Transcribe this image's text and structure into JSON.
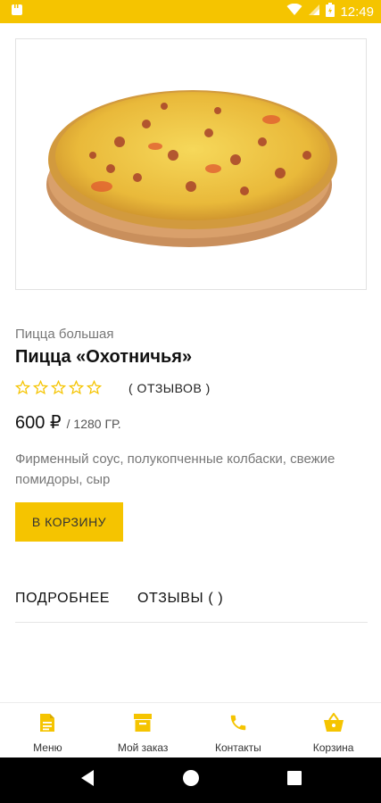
{
  "status_bar": {
    "time": "12:49",
    "icons": [
      "notification-icon",
      "wifi-icon",
      "signal-icon",
      "battery-icon"
    ]
  },
  "product": {
    "image": "pizza-image",
    "category": "Пицца большая",
    "title": "Пицца «Охотничья»",
    "rating": {
      "stars_filled": 0,
      "stars_total": 5,
      "reviews_label": "(  ОТЗЫВОВ )"
    },
    "price": "600 ₽",
    "weight": "/ 1280 ГР.",
    "description": "Фирменный соус, полукопченные колбаски, свежие помидоры, сыр"
  },
  "actions": {
    "add_to_cart": "В КОРЗИНУ"
  },
  "tabs": [
    {
      "label": "ПОДРОБНЕЕ"
    },
    {
      "label": "ОТЗЫВЫ (  )"
    }
  ],
  "bottom_nav": [
    {
      "label": "Меню",
      "icon": "menu-document-icon"
    },
    {
      "label": "Мой заказ",
      "icon": "order-box-icon"
    },
    {
      "label": "Контакты",
      "icon": "phone-icon"
    },
    {
      "label": "Корзина",
      "icon": "basket-icon"
    }
  ],
  "system_nav": [
    "back-icon",
    "home-icon",
    "recents-icon"
  ],
  "colors": {
    "accent": "#f5c400",
    "text": "#111111",
    "muted": "#777777"
  }
}
